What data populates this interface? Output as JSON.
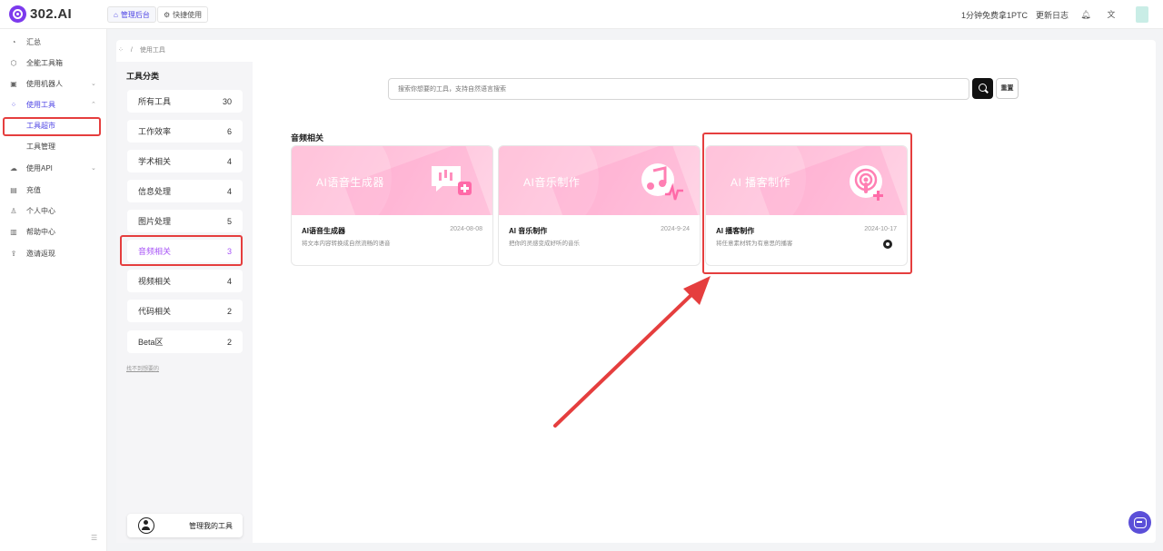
{
  "app": {
    "logo_text": "302.AI"
  },
  "header": {
    "tabs": [
      {
        "label": "管理后台",
        "icon": "home-icon"
      },
      {
        "label": "快捷使用",
        "icon": "gear-icon"
      }
    ],
    "promo": "1分钟免费拿1PTC",
    "changelog": "更新日志",
    "icons": [
      "bell-icon",
      "translate-icon"
    ]
  },
  "nav": {
    "items": [
      {
        "label": "汇总",
        "icon": "dashboard-icon"
      },
      {
        "label": "全能工具箱",
        "icon": "toolbox-icon"
      },
      {
        "label": "使用机器人",
        "icon": "robot-icon",
        "chevron": "down"
      },
      {
        "label": "使用工具",
        "icon": "apps-icon",
        "chevron": "up"
      },
      {
        "label": "工具超市",
        "sub": true
      },
      {
        "label": "工具管理",
        "sub": true
      },
      {
        "label": "使用API",
        "icon": "cloud-icon",
        "chevron": "down"
      },
      {
        "label": "充值",
        "icon": "wallet-icon"
      },
      {
        "label": "个人中心",
        "icon": "user-icon"
      },
      {
        "label": "帮助中心",
        "icon": "book-icon"
      },
      {
        "label": "邀请返现",
        "icon": "share-icon"
      }
    ]
  },
  "breadcrumb": {
    "current": "使用工具"
  },
  "categories": {
    "title": "工具分类",
    "items": [
      {
        "label": "所有工具",
        "count": "30"
      },
      {
        "label": "工作效率",
        "count": "6"
      },
      {
        "label": "学术相关",
        "count": "4"
      },
      {
        "label": "信息处理",
        "count": "4"
      },
      {
        "label": "图片处理",
        "count": "5"
      },
      {
        "label": "音频相关",
        "count": "3",
        "active": true
      },
      {
        "label": "视频相关",
        "count": "4"
      },
      {
        "label": "代码相关",
        "count": "2"
      },
      {
        "label": "Beta区",
        "count": "2"
      }
    ],
    "not_found_link": "找不到想要的",
    "manage_button": "管理我的工具"
  },
  "search": {
    "placeholder": "搜索你想要的工具，支持自然语言搜索",
    "reset_label": "重置"
  },
  "section": {
    "title": "音频相关"
  },
  "cards": [
    {
      "banner_title": "AI语音生成器",
      "name": "AI语音生成器",
      "date": "2024-08-08",
      "description": "将文本内容转换成自然流畅的语音",
      "icon": "speech-bubble-plus-icon"
    },
    {
      "banner_title": "AI音乐制作",
      "name": "AI 音乐制作",
      "date": "2024-9-24",
      "description": "把你的灵感变成好听的音乐",
      "icon": "music-note-icon"
    },
    {
      "banner_title": "AI 播客制作",
      "name": "AI 播客制作",
      "date": "2024-10-17",
      "description": "将任意素材转为有意思的播客",
      "icon": "podcast-icon",
      "github": true
    }
  ],
  "colors": {
    "accent": "#4f46e5",
    "category_active": "#a855f7",
    "highlight": "#e53e3e",
    "banner": "#ffb5d2"
  }
}
